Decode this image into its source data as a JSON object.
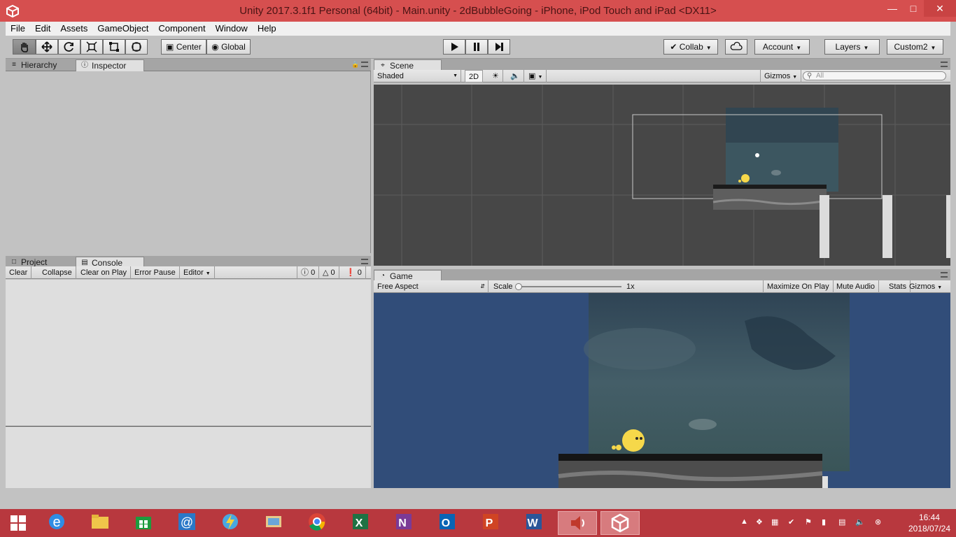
{
  "window": {
    "title": "Unity 2017.3.1f1 Personal (64bit) - Main.unity - 2dBubbleGoing - iPhone, iPod Touch and iPad <DX11>",
    "controls": [
      "minimize",
      "maximize",
      "close"
    ]
  },
  "menu": [
    "File",
    "Edit",
    "Assets",
    "GameObject",
    "Component",
    "Window",
    "Help"
  ],
  "toolbar": {
    "tools": [
      "hand-tool",
      "move-tool",
      "rotate-tool",
      "scale-tool",
      "rect-tool",
      "transform-tool"
    ],
    "pivot": "Center",
    "space": "Global",
    "play": [
      "play",
      "pause",
      "step"
    ],
    "collab": "Collab",
    "account": "Account",
    "layers": "Layers",
    "layout": "Custom2"
  },
  "left_top": {
    "tabs": [
      "Hierarchy",
      "Inspector"
    ],
    "active": "Inspector"
  },
  "left_bottom": {
    "tabs": [
      "Project",
      "Console"
    ],
    "active": "Console",
    "buttons": [
      "Clear",
      "Collapse",
      "Clear on Play",
      "Error Pause",
      "Editor"
    ],
    "counts": {
      "info": "0",
      "warn": "0",
      "error": "0"
    }
  },
  "scene": {
    "tab": "Scene",
    "shading": "Shaded",
    "mode_2d": "2D",
    "gizmos": "Gizmos",
    "search_placeholder": "All"
  },
  "game": {
    "tab": "Game",
    "aspect": "Free Aspect",
    "scale_label": "Scale",
    "scale_value": "1x",
    "buttons": [
      "Maximize On Play",
      "Mute Audio",
      "Stats",
      "Gizmos"
    ]
  },
  "taskbar": {
    "apps": [
      "windows-start",
      "internet-explorer",
      "file-explorer",
      "store",
      "mail",
      "ms-flow",
      "remote-desktop",
      "chrome",
      "excel",
      "onenote",
      "outlook",
      "powerpoint",
      "word",
      "audio-app",
      "unity"
    ],
    "time": "16:44",
    "date": "2018/07/24"
  },
  "colors": {
    "titlebar": "#d64f4f",
    "taskbar": "#b8383e",
    "scene_bg": "#474747",
    "game_bg": "#314d79"
  }
}
